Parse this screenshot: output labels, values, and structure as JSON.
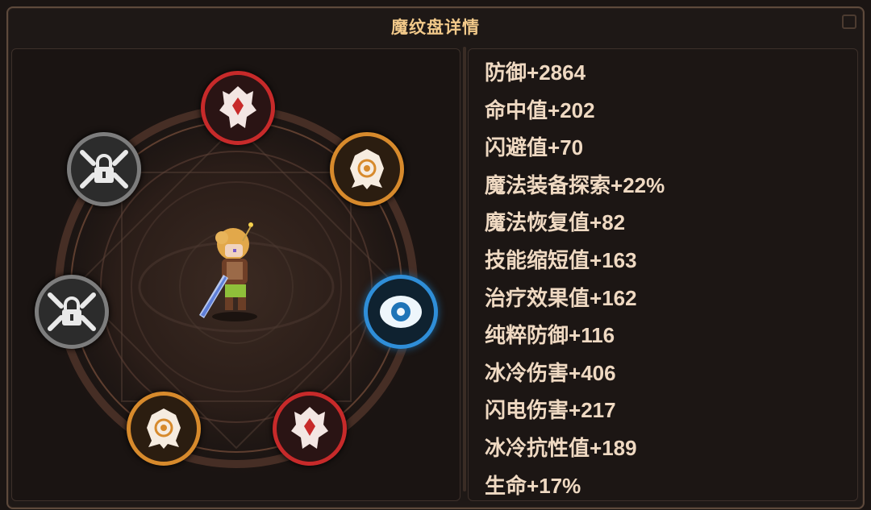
{
  "window": {
    "title": "魔纹盘详情"
  },
  "stats": [
    {
      "label": "防御",
      "value": "+2864"
    },
    {
      "label": "命中值",
      "value": "+202"
    },
    {
      "label": "闪避值",
      "value": "+70"
    },
    {
      "label": "魔法装备探索",
      "value": "+22%"
    },
    {
      "label": "魔法恢复值",
      "value": "+82"
    },
    {
      "label": "技能缩短值",
      "value": "+163"
    },
    {
      "label": "治疗效果值",
      "value": "+162"
    },
    {
      "label": "纯粹防御",
      "value": "+116"
    },
    {
      "label": "冰冷伤害",
      "value": "+406"
    },
    {
      "label": "闪电伤害",
      "value": "+217"
    },
    {
      "label": "冰冷抗性值",
      "value": "+189"
    },
    {
      "label": "生命",
      "value": "+17%"
    }
  ],
  "slots": [
    {
      "name": "slot-top",
      "type": "red-crest",
      "color": "#c72a2a"
    },
    {
      "name": "slot-top-right",
      "type": "gold-swirl",
      "color": "#d78a2c"
    },
    {
      "name": "slot-right",
      "type": "blue-eye",
      "color": "#2f8ed8"
    },
    {
      "name": "slot-bottom-right",
      "type": "red-crest",
      "color": "#c72a2a"
    },
    {
      "name": "slot-bottom-left",
      "type": "gold-swirl",
      "color": "#d78a2c"
    },
    {
      "name": "slot-left",
      "type": "locked",
      "color": "#7d7d7d"
    },
    {
      "name": "slot-top-left",
      "type": "locked",
      "color": "#7d7d7d"
    }
  ]
}
